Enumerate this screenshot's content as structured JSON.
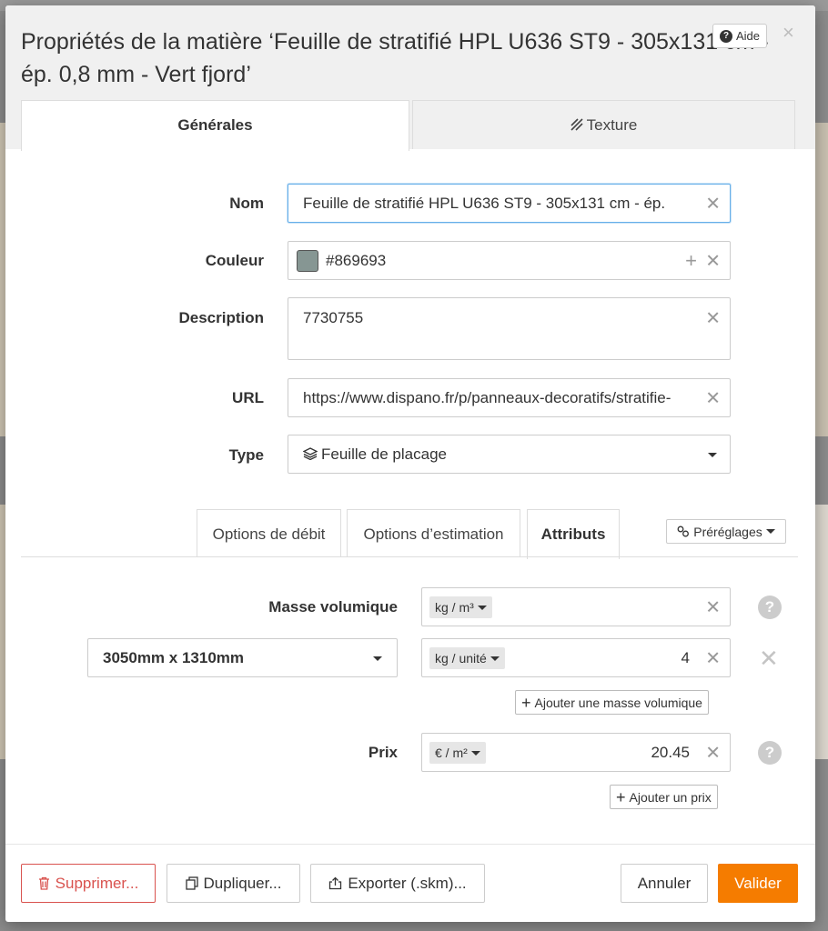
{
  "dialog": {
    "title": "Propriétés de la matière ‘Feuille de stratifié HPL U636 ST9 - 305x131 cm - ép. 0,8 mm - Vert fjord’",
    "help_label": "Aide",
    "close_glyph": "×"
  },
  "tabs": [
    {
      "label": "Générales",
      "active": true
    },
    {
      "label": "Texture",
      "icon": "texture-icon",
      "active": false
    }
  ],
  "form": {
    "name": {
      "label": "Nom",
      "value": "Feuille de stratifié HPL U636 ST9 - 305x131 cm - ép."
    },
    "color": {
      "label": "Couleur",
      "value": "#869693",
      "swatch": "#869693"
    },
    "description": {
      "label": "Description",
      "value": "7730755"
    },
    "url": {
      "label": "URL",
      "value": "https://www.dispano.fr/p/panneaux-decoratifs/stratifie-"
    },
    "type": {
      "label": "Type",
      "value": "Feuille de placage",
      "icon": "layers-icon"
    }
  },
  "subtabs": [
    {
      "label": "Options de débit",
      "active": false
    },
    {
      "label": "Options d’estimation",
      "active": false
    },
    {
      "label": "Attributs",
      "active": true
    }
  ],
  "presets_label": "Préréglages",
  "attributes": {
    "density": {
      "label": "Masse volumique",
      "unit": "kg / m³",
      "value": ""
    },
    "density_row": {
      "dimension": "3050mm x 1310mm",
      "unit": "kg / unité",
      "value": "4"
    },
    "add_density_label": "Ajouter une masse volumique",
    "price": {
      "label": "Prix",
      "unit": "€ / m²",
      "value": "20.45"
    },
    "add_price_label": "Ajouter un prix"
  },
  "footer": {
    "delete_label": "Supprimer...",
    "duplicate_label": "Dupliquer...",
    "export_label": "Exporter (.skm)...",
    "cancel_label": "Annuler",
    "validate_label": "Valider"
  },
  "colors": {
    "accent": "#f57c00",
    "danger": "#d9534f",
    "swatch": "#869693"
  }
}
